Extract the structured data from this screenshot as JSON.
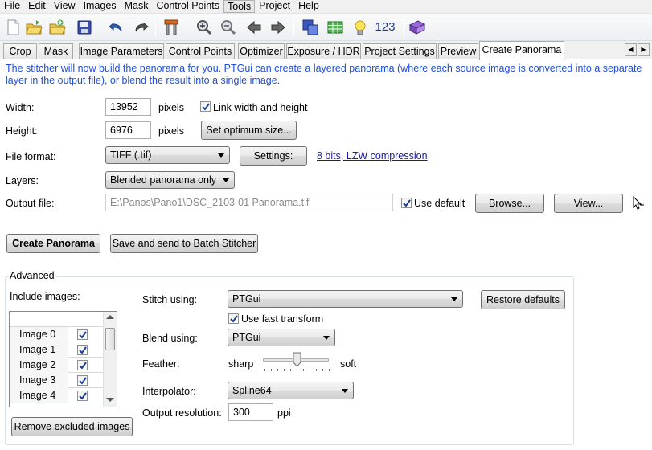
{
  "menu": {
    "items": [
      "File",
      "Edit",
      "View",
      "Images",
      "Mask",
      "Control Points",
      "Tools",
      "Project",
      "Help"
    ],
    "active_index": 6
  },
  "toolbar": {
    "icons": [
      "new-project-icon",
      "open-project-icon",
      "load-images-icon",
      "save-project-icon",
      "undo-icon",
      "redo-icon",
      "tools-icon",
      "zoom-in-icon",
      "zoom-out-icon",
      "back-icon",
      "forward-icon",
      "detail-viewer-icon",
      "table-icon",
      "bulb-icon",
      "numbering-icon",
      "batch-icon"
    ],
    "numbering_label": "123"
  },
  "tabs": [
    "Crop",
    "Mask",
    "Image Parameters",
    "Control Points",
    "Optimizer",
    "Exposure / HDR",
    "Project Settings",
    "Preview",
    "Create Panorama"
  ],
  "active_tab_index": 8,
  "info_text": "The stitcher will now build the panorama for you. PTGui can create a layered panorama (where each source image is converted into a separate layer in the output file), or blend the result into a single image.",
  "form": {
    "width_label": "Width:",
    "width_value": "13952",
    "height_label": "Height:",
    "height_value": "6976",
    "pixels_label": "pixels",
    "link_label": "Link width and height",
    "link_checked": true,
    "optimum_button": "Set optimum size...",
    "file_format_label": "File format:",
    "file_format_value": "TIFF (.tif)",
    "settings_button": "Settings:",
    "settings_link": "8 bits, LZW compression",
    "layers_label": "Layers:",
    "layers_value": "Blended panorama only",
    "output_file_label": "Output file:",
    "output_file_value": "E:\\Panos\\Pano1\\DSC_2103-01 Panorama.tif",
    "use_default_label": "Use default",
    "use_default_checked": true,
    "browse_button": "Browse...",
    "view_button": "View..."
  },
  "actions": {
    "create_button": "Create Panorama",
    "batch_button": "Save and send to Batch Stitcher"
  },
  "advanced": {
    "legend": "Advanced",
    "include_label": "Include images:",
    "images": [
      {
        "name": "Image 0",
        "checked": true
      },
      {
        "name": "Image 1",
        "checked": true
      },
      {
        "name": "Image 2",
        "checked": true
      },
      {
        "name": "Image 3",
        "checked": true
      },
      {
        "name": "Image 4",
        "checked": true
      }
    ],
    "remove_button": "Remove excluded images",
    "stitch_label": "Stitch using:",
    "stitch_value": "PTGui",
    "restore_button": "Restore defaults",
    "fast_transform_label": "Use fast transform",
    "fast_transform_checked": true,
    "blend_label": "Blend using:",
    "blend_value": "PTGui",
    "feather_label": "Feather:",
    "feather_sharp": "sharp",
    "feather_soft": "soft",
    "feather_level": 0.5,
    "interpolator_label": "Interpolator:",
    "interpolator_value": "Spline64",
    "resolution_label": "Output resolution:",
    "resolution_value": "300",
    "resolution_unit": "ppi"
  }
}
